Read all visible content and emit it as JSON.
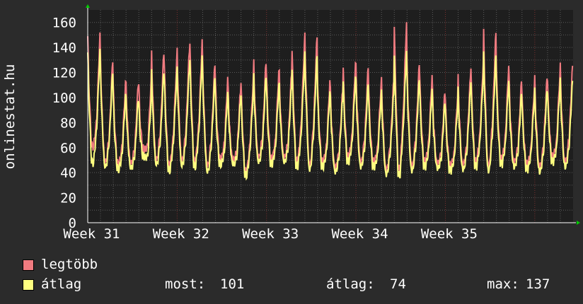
{
  "chart_data": {
    "type": "line",
    "ylabel": "onlinestat.hu",
    "ylim": [
      0,
      170
    ],
    "yticks": [
      0,
      20,
      40,
      60,
      80,
      100,
      120,
      140,
      160
    ],
    "xticks": [
      "Week 31",
      "Week 32",
      "Week 33",
      "Week 34",
      "Week 35"
    ],
    "grid": true,
    "background_color": "#1e1e1e",
    "grid_color": "#5a5a5a",
    "x_unit": "day",
    "series": [
      {
        "name": "legtöbb",
        "color": "#f07b80",
        "daily_peaks": [
          149,
          131,
          110,
          112,
          111,
          137,
          126,
          139,
          144,
          128,
          114,
          106,
          113,
          129,
          119,
          120,
          139,
          150,
          112,
          106,
          126,
          125,
          108,
          114,
          159,
          127,
          117,
          104,
          101,
          116,
          126,
          152,
          125,
          113,
          106,
          115,
          116,
          125
        ],
        "daily_lows": [
          60,
          48,
          46,
          47,
          58,
          50,
          45,
          49,
          48,
          45,
          50,
          50,
          40,
          52,
          50,
          52,
          48,
          46,
          48,
          44,
          52,
          48,
          48,
          42,
          42,
          45,
          48,
          47,
          45,
          46,
          48,
          45,
          50,
          48,
          46,
          44,
          52,
          48
        ]
      },
      {
        "name": "átlag",
        "color": "#ffff80",
        "daily_peaks": [
          136,
          122,
          100,
          100,
          96,
          122,
          114,
          124,
          131,
          118,
          102,
          98,
          103,
          118,
          108,
          110,
          124,
          135,
          103,
          99,
          115,
          112,
          98,
          104,
          136,
          115,
          106,
          96,
          93,
          106,
          115,
          134,
          113,
          103,
          98,
          105,
          106,
          113
        ],
        "daily_lows": [
          47,
          44,
          42,
          43,
          52,
          46,
          41,
          45,
          44,
          40,
          46,
          46,
          37,
          48,
          46,
          48,
          44,
          42,
          44,
          40,
          48,
          44,
          44,
          38,
          37,
          41,
          44,
          43,
          41,
          42,
          44,
          41,
          46,
          44,
          42,
          40,
          48,
          44
        ]
      }
    ]
  },
  "legend": {
    "items": [
      {
        "label": "legtöbb",
        "color": "#f07b80"
      },
      {
        "label": "átlag",
        "color": "#ffff80"
      }
    ],
    "stats": {
      "most_label": "most:",
      "most_value": "101",
      "atlag_label": "átlag:",
      "atlag_value": "74",
      "max_label": "max:",
      "max_value": "137"
    }
  }
}
